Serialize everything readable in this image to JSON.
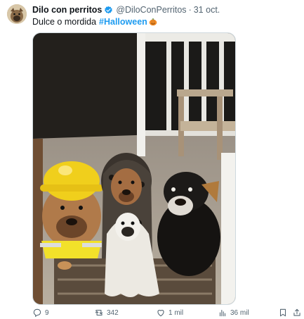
{
  "tweet": {
    "author_name": "Dilo con perritos",
    "handle": "@DiloConPerritos",
    "separator": "·",
    "date": "31 oct.",
    "text": "Dulce o mordida",
    "hashtag": "#Halloween",
    "emoji_icon": "pumpkin-icon",
    "media_icon": "photo-four-dogs-in-halloween-costumes"
  },
  "actions": {
    "replies": "9",
    "retweets": "342",
    "likes": "1 mil",
    "views": "36 mil"
  },
  "colors": {
    "link": "#1d9bf0",
    "secondary_text": "#536471",
    "verified_badge": "#1d9bf0"
  }
}
